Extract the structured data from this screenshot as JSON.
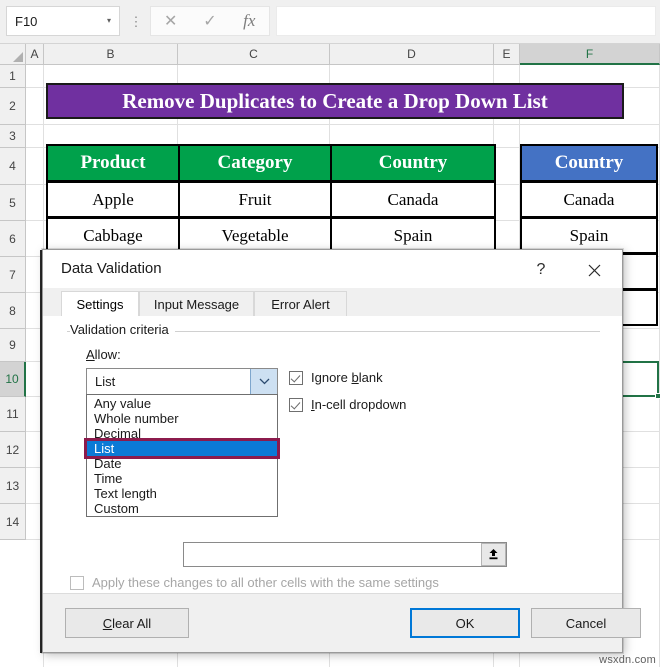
{
  "formula_bar": {
    "name_box_value": "F10",
    "name_box_caret": "▾",
    "cancel_icon": "✕",
    "enter_icon": "✓",
    "function_icon": "fx",
    "formula_value": "",
    "more_icon": "⋮"
  },
  "grid": {
    "columns": [
      "A",
      "B",
      "C",
      "D",
      "E",
      "F"
    ],
    "selected_column": "F",
    "rows": [
      "1",
      "2",
      "3",
      "4",
      "5",
      "6",
      "7",
      "8",
      "9",
      "10",
      "11",
      "12",
      "13",
      "14"
    ],
    "selected_row": "10",
    "selected_cell": "F10"
  },
  "sheet": {
    "banner_title": "Remove Duplicates to Create a Drop Down List",
    "banner_color": "#7030a0",
    "main_table": {
      "headers": [
        "Product",
        "Category",
        "Country"
      ],
      "header_color": "#00a14b",
      "rows": [
        [
          "Apple",
          "Fruit",
          "Canada"
        ],
        [
          "Cabbage",
          "Vegetable",
          "Spain"
        ]
      ]
    },
    "side_table": {
      "header": "Country",
      "header_color": "#4472c4",
      "rows": [
        "Canada",
        "Spain"
      ]
    }
  },
  "dialog": {
    "title": "Data Validation",
    "help_icon": "?",
    "close_icon": "✕",
    "tabs": [
      {
        "label": "Settings",
        "active": true
      },
      {
        "label": "Input Message",
        "active": false
      },
      {
        "label": "Error Alert",
        "active": false
      }
    ],
    "group_label": "Validation criteria",
    "allow_label": "Allow:",
    "allow_value": "List",
    "allow_arrow": "⌄",
    "allow_options": [
      "Any value",
      "Whole number",
      "Decimal",
      "List",
      "Date",
      "Time",
      "Text length",
      "Custom"
    ],
    "allow_selected_option": "List",
    "highlight_color": "#8c1b4c",
    "selection_color": "#0b7ad6",
    "checkboxes": [
      {
        "label": "Ignore blank",
        "checked": true
      },
      {
        "label": "In-cell dropdown",
        "checked": true
      }
    ],
    "source_value": "",
    "source_picker_icon": "⬆",
    "apply_label": "Apply these changes to all other cells with the same settings",
    "apply_checked": false,
    "buttons": {
      "clear_all": "Clear All",
      "ok": "OK",
      "cancel": "Cancel"
    }
  },
  "watermark": "wsxdn.com"
}
